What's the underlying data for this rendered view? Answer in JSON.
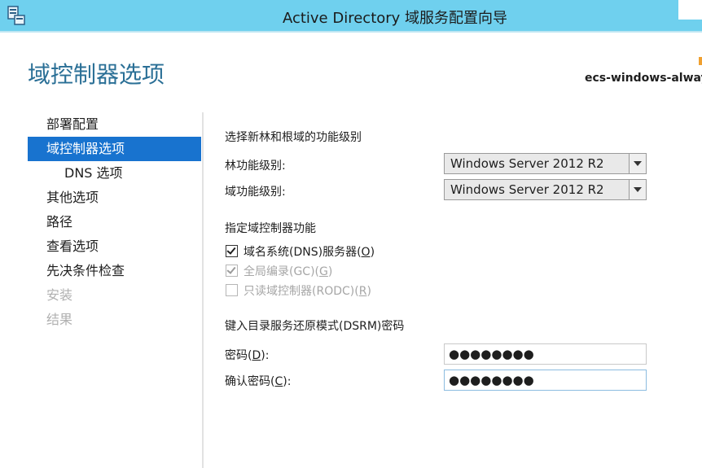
{
  "window": {
    "title": "Active Directory 域服务配置向导"
  },
  "header": {
    "page_title": "域控制器选项",
    "server_name": "ecs-windows-alway"
  },
  "nav": {
    "items": [
      {
        "label": "部署配置"
      },
      {
        "label": "域控制器选项"
      },
      {
        "label": "DNS 选项"
      },
      {
        "label": "其他选项"
      },
      {
        "label": "路径"
      },
      {
        "label": "查看选项"
      },
      {
        "label": "先决条件检查"
      },
      {
        "label": "安装"
      },
      {
        "label": "结果"
      }
    ]
  },
  "functional_levels": {
    "heading": "选择新林和根域的功能级别",
    "forest_label": "林功能级别:",
    "forest_value": "Windows Server 2012 R2",
    "domain_label": "域功能级别:",
    "domain_value": "Windows Server 2012 R2"
  },
  "capabilities": {
    "heading": "指定域控制器功能",
    "dns": {
      "label": "域名系统(DNS)服务器(",
      "key": "O",
      "suffix": ")",
      "checked": true
    },
    "gc": {
      "label": "全局编录(GC)(",
      "key": "G",
      "suffix": ")",
      "checked": true
    },
    "rodc": {
      "label": "只读域控制器(RODC)(",
      "key": "R",
      "suffix": ")",
      "checked": false
    }
  },
  "dsrm": {
    "heading": "键入目录服务还原模式(DSRM)密码",
    "password_label": "密码(",
    "password_key": "D",
    "password_suffix": "):",
    "password_value": "●●●●●●●●",
    "confirm_label": "确认密码(",
    "confirm_key": "C",
    "confirm_suffix": "):",
    "confirm_value": "●●●●●●●●"
  }
}
